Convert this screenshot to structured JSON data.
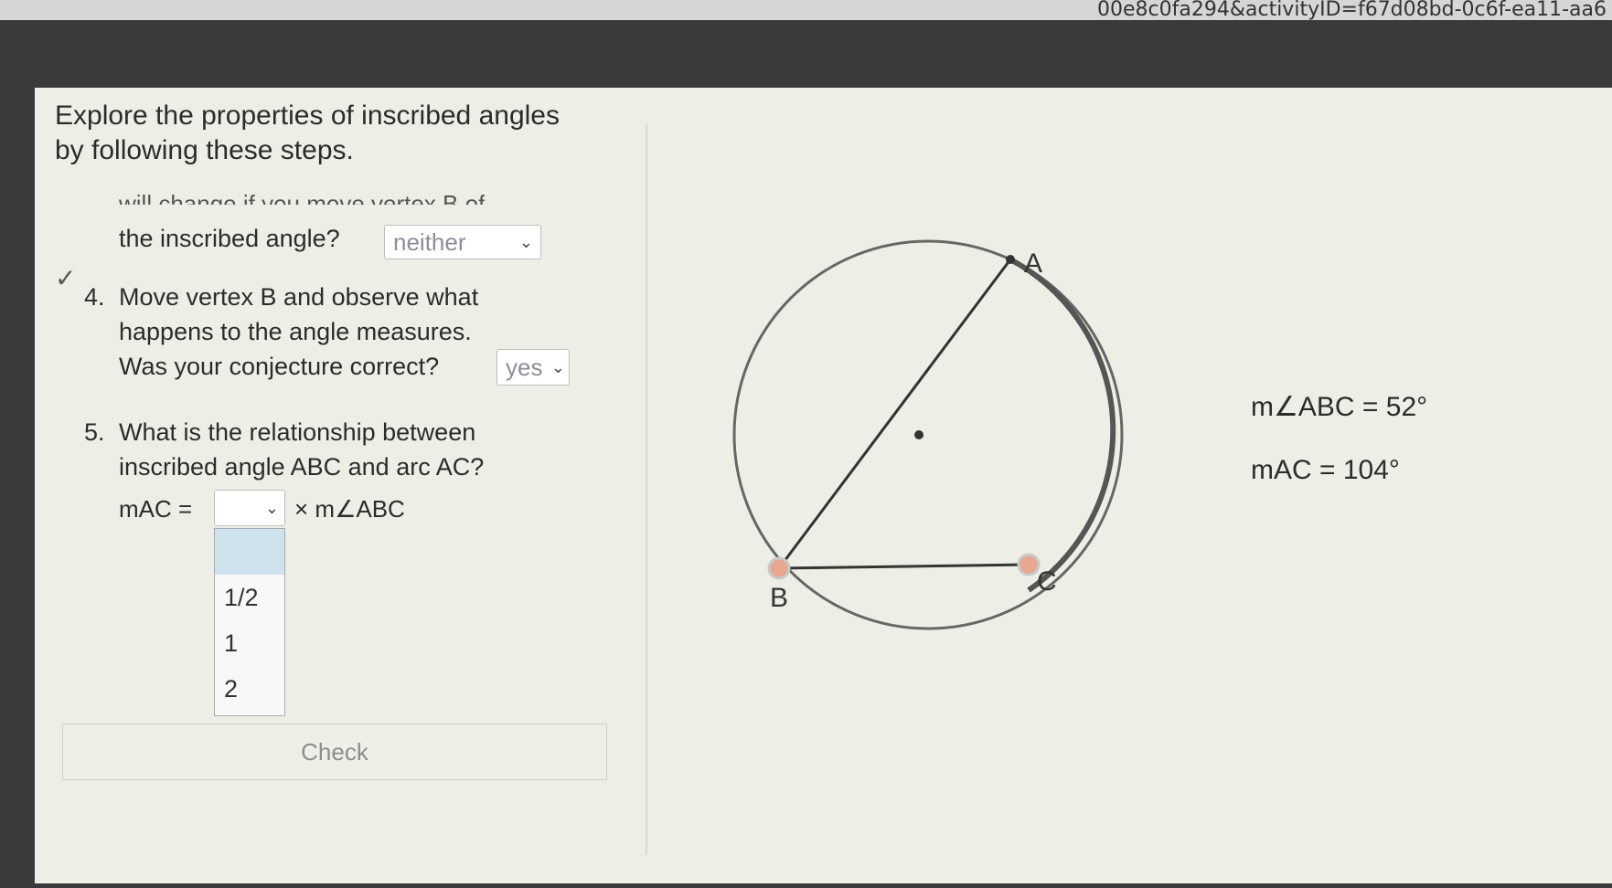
{
  "browser": {
    "url_fragment": "00e8c0fa294&activityID=f67d08bd-0c6f-ea11-aa6"
  },
  "intro": {
    "line1": "Explore the properties of inscribed angles",
    "line2": "by following these steps."
  },
  "step3": {
    "cut_text": "will change if you move vertex B of",
    "question": "the inscribed angle?",
    "answer_value": "neither"
  },
  "step4": {
    "check_mark": "✓",
    "number": "4.",
    "line1": "Move vertex B and observe what",
    "line2": "happens to the angle measures.",
    "question": "Was your conjecture correct?",
    "answer_value": "yes"
  },
  "step5": {
    "number": "5.",
    "line1": "What is the relationship between",
    "line2": "inscribed angle ABC and arc AC?",
    "formula_left": "mAC =",
    "formula_right": "× m∠ABC",
    "dropdown_options": [
      "1/2",
      "1",
      "2"
    ]
  },
  "check_button": {
    "label": "Check"
  },
  "diagram": {
    "points": {
      "A": "A",
      "B": "B",
      "C": "C"
    },
    "angle_label": "m∠ABC = 52°",
    "arc_label": "mAC = 104°",
    "angle_value_deg": 52,
    "arc_value_deg": 104
  },
  "colors": {
    "panel": "#efeee6",
    "highlight": "#cfe3ee",
    "point": "#e8a790"
  }
}
